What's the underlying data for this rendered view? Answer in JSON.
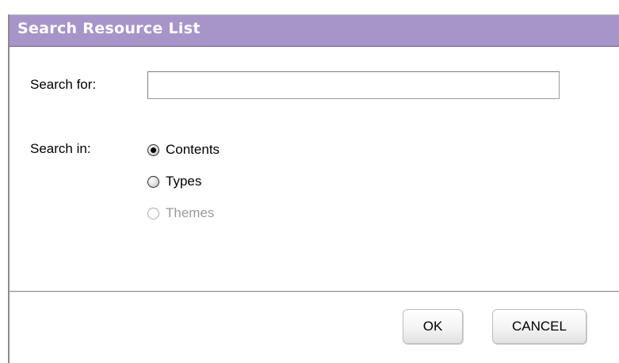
{
  "dialog": {
    "title": "Search Resource List",
    "search_for_label": "Search for:",
    "search_value": "",
    "search_in_label": "Search in:",
    "options": [
      {
        "label": "Contents",
        "selected": true,
        "enabled": true
      },
      {
        "label": "Types",
        "selected": false,
        "enabled": true
      },
      {
        "label": "Themes",
        "selected": false,
        "enabled": false
      }
    ],
    "ok_label": "OK",
    "cancel_label": "CANCEL"
  },
  "colors": {
    "titlebar": "#a795c9",
    "title_text": "#ffffff",
    "disabled_text": "#9a9a9a"
  }
}
